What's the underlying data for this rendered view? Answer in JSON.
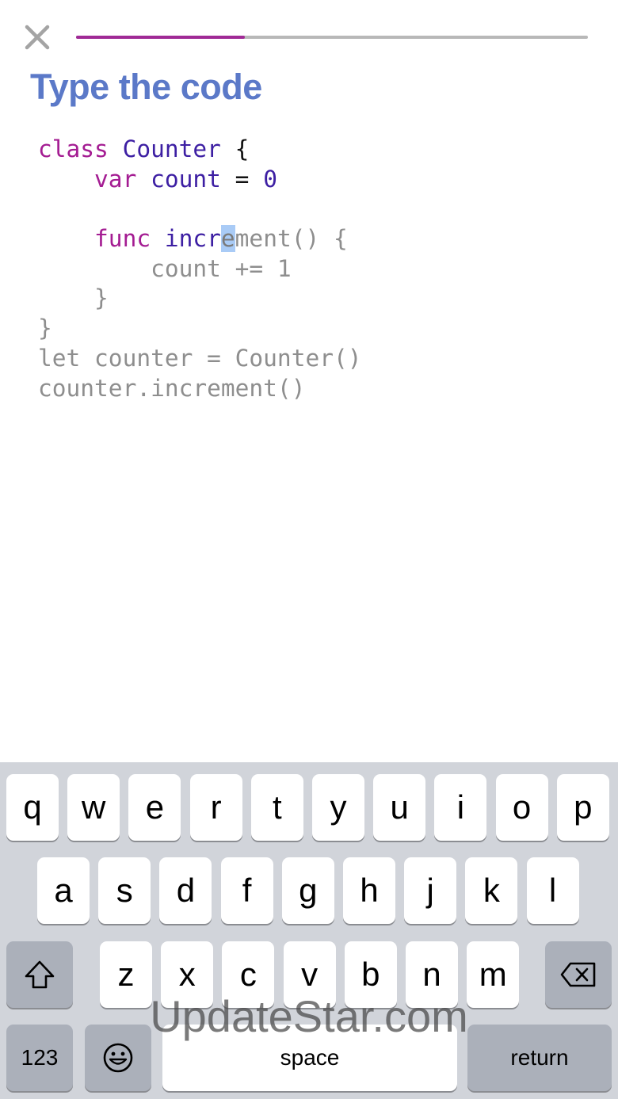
{
  "header": {
    "close_icon": "close-x-icon",
    "progress": 0.33,
    "progress_fill_color": "#a02a96",
    "progress_track_color": "#b8b8b8"
  },
  "title": "Type the code",
  "code": {
    "lines": [
      [
        {
          "t": "class",
          "s": "kw"
        },
        {
          "t": " ",
          "s": "plain"
        },
        {
          "t": "Counter",
          "s": "type"
        },
        {
          "t": " {",
          "s": "plain"
        }
      ],
      [
        {
          "t": "    ",
          "s": "plain"
        },
        {
          "t": "var",
          "s": "kw"
        },
        {
          "t": " ",
          "s": "plain"
        },
        {
          "t": "count",
          "s": "type"
        },
        {
          "t": " = ",
          "s": "plain"
        },
        {
          "t": "0",
          "s": "num"
        }
      ],
      [],
      [
        {
          "t": "    ",
          "s": "plain"
        },
        {
          "t": "func",
          "s": "kw"
        },
        {
          "t": " ",
          "s": "plain"
        },
        {
          "t": "incr",
          "s": "type"
        },
        {
          "t": "e",
          "s": "cursor"
        },
        {
          "t": "ment() {",
          "s": "dim"
        }
      ],
      [
        {
          "t": "        count += 1",
          "s": "dim"
        }
      ],
      [
        {
          "t": "    }",
          "s": "dim"
        }
      ],
      [
        {
          "t": "}",
          "s": "dim"
        }
      ],
      [
        {
          "t": "let counter = Counter()",
          "s": "dim"
        }
      ],
      [
        {
          "t": "counter.increment()",
          "s": "dim"
        }
      ]
    ]
  },
  "keyboard": {
    "row1": [
      "q",
      "w",
      "e",
      "r",
      "t",
      "y",
      "u",
      "i",
      "o",
      "p"
    ],
    "row2": [
      "a",
      "s",
      "d",
      "f",
      "g",
      "h",
      "j",
      "k",
      "l"
    ],
    "row3": [
      "z",
      "x",
      "c",
      "v",
      "b",
      "n",
      "m"
    ],
    "shift_icon": "shift-arrow-icon",
    "delete_icon": "backspace-icon",
    "numbers_label": "123",
    "emoji_icon": "emoji-face-icon",
    "space_label": "space",
    "return_label": "return"
  },
  "watermark": "UpdateStar.com"
}
